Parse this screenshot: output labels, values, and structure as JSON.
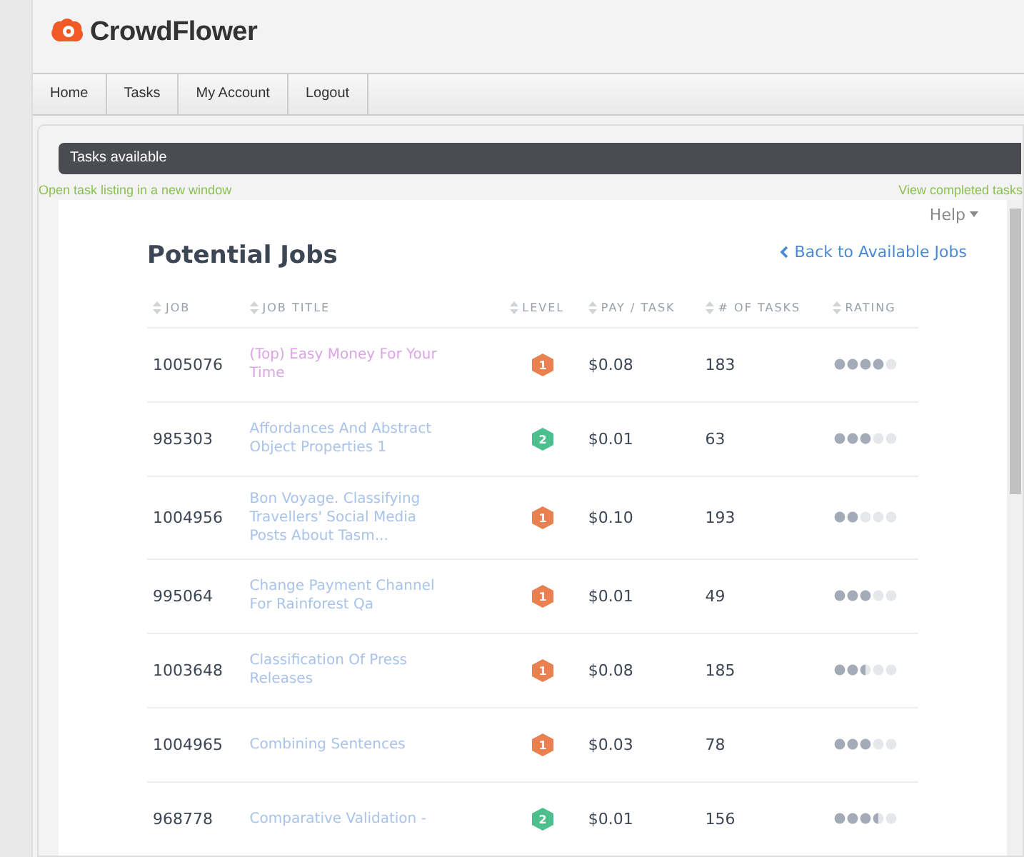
{
  "header": {
    "logo_text": "CrowdFlower"
  },
  "nav": [
    {
      "label": "Home",
      "selected": false
    },
    {
      "label": "Tasks",
      "selected": false
    },
    {
      "label": "My Account",
      "selected": false
    },
    {
      "label": "Logout",
      "selected": false
    }
  ],
  "panel": {
    "title": "Tasks available",
    "left_link": "Open task listing in a new window",
    "right_link": "View completed tasks"
  },
  "help": "Help",
  "heading": "Potential Jobs",
  "back_link": "Back to Available Jobs",
  "table": {
    "columns": [
      "JOB",
      "JOB TITLE",
      "LEVEL",
      "PAY / TASK",
      "# OF TASKS",
      "RATING"
    ],
    "rows": [
      {
        "job": "1005076",
        "title": "(Top) Easy Money For Your Time",
        "visited": true,
        "level": "1",
        "color": "#e8804f",
        "pay": "$0.08",
        "tasks": "183",
        "stars": 4
      },
      {
        "job": "985303",
        "title": "Affordances And Abstract Object Properties 1",
        "visited": false,
        "level": "2",
        "color": "#4cbf8c",
        "pay": "$0.01",
        "tasks": "63",
        "stars": 3
      },
      {
        "job": "1004956",
        "title": "Bon Voyage. Classifying Travellers' Social Media Posts About Tasm...",
        "visited": false,
        "level": "1",
        "color": "#e8804f",
        "pay": "$0.10",
        "tasks": "193",
        "stars": 2
      },
      {
        "job": "995064",
        "title": "Change Payment Channel For Rainforest Qa",
        "visited": false,
        "level": "1",
        "color": "#e8804f",
        "pay": "$0.01",
        "tasks": "49",
        "stars": 3
      },
      {
        "job": "1003648",
        "title": "Classification Of Press Releases",
        "visited": false,
        "level": "1",
        "color": "#e8804f",
        "pay": "$0.08",
        "tasks": "185",
        "stars": 2.5
      },
      {
        "job": "1004965",
        "title": "Combining Sentences",
        "visited": false,
        "level": "1",
        "color": "#e8804f",
        "pay": "$0.03",
        "tasks": "78",
        "stars": 3
      },
      {
        "job": "968778",
        "title": "Comparative Validation -",
        "visited": false,
        "level": "2",
        "color": "#4cbf8c",
        "pay": "$0.01",
        "tasks": "156",
        "stars": 3.5
      }
    ]
  }
}
